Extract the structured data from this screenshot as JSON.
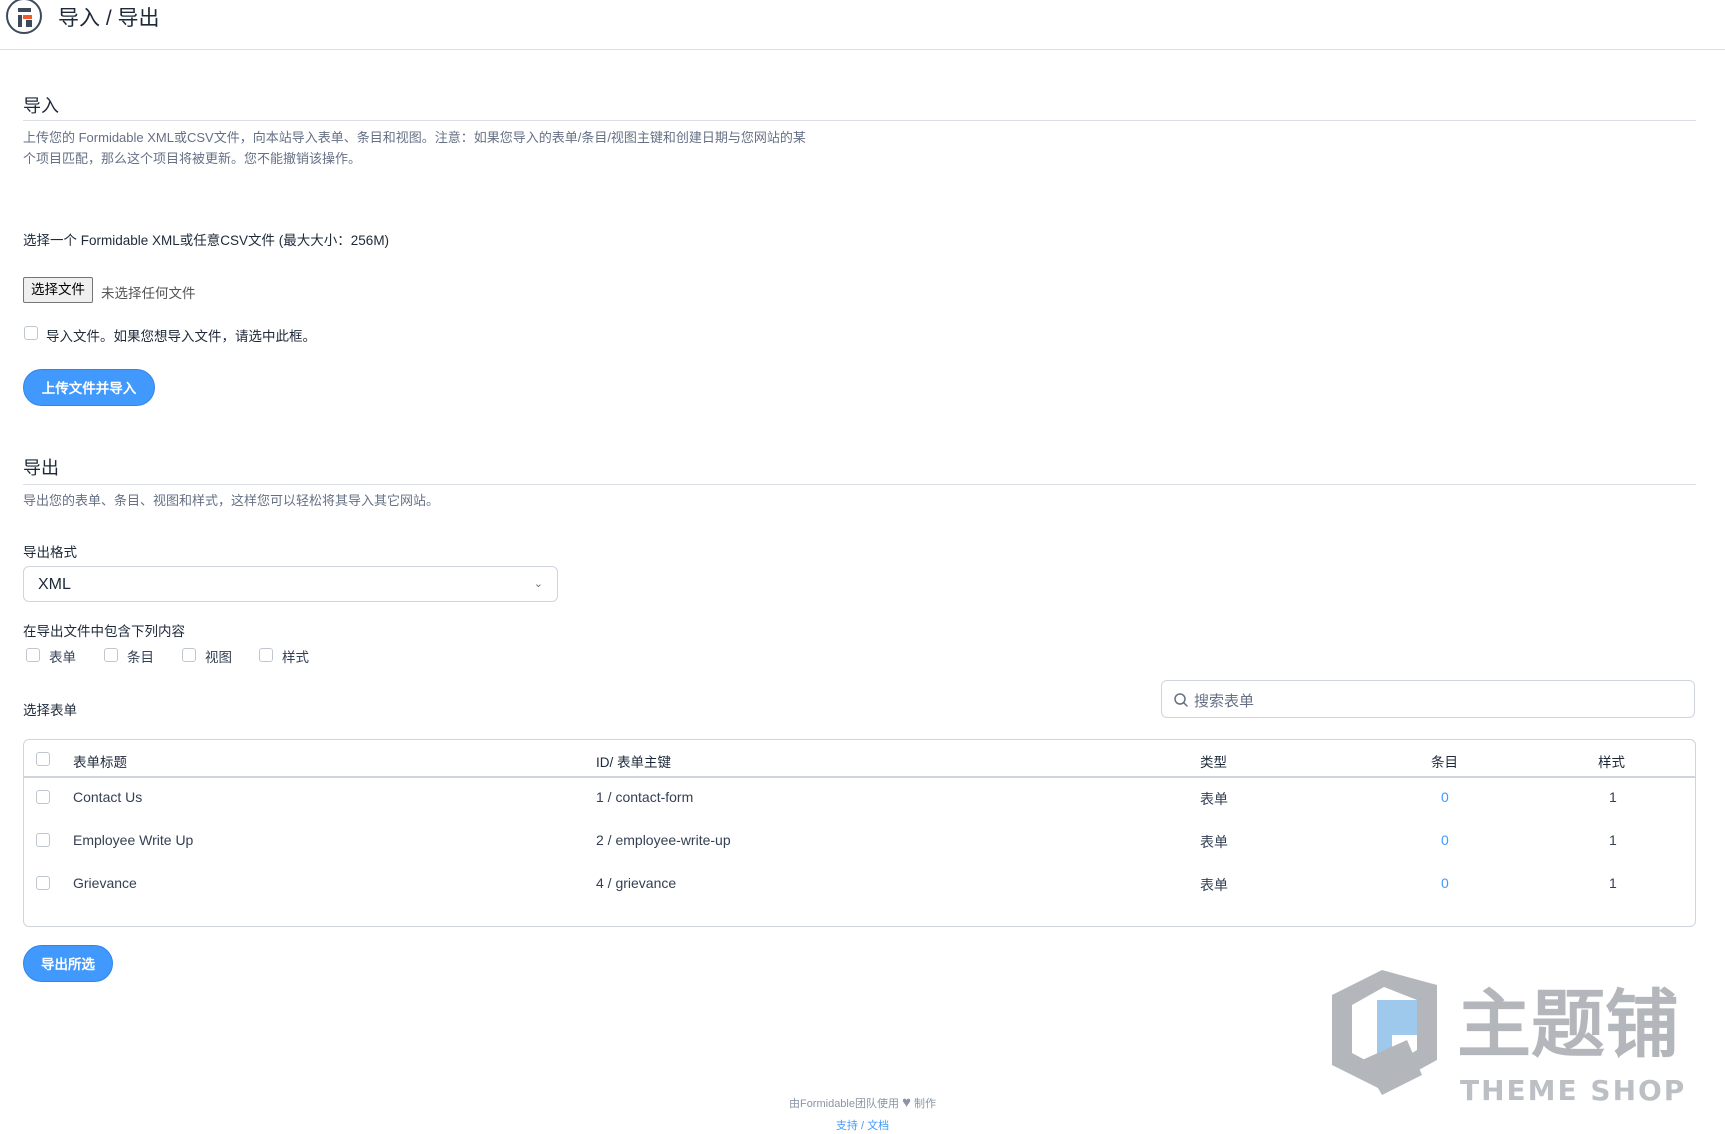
{
  "header": {
    "title": "导入 / 导出"
  },
  "import": {
    "title": "导入",
    "desc_line1": "上传您的 Formidable XML或CSV文件，向本站导入表单、条目和视图。注意：如果您导入的表单/条目/视图主键和创建日期与您网站的某",
    "desc_line2": "个项目匹配，那么这个项目将被更新。您不能撤销该操作。",
    "file_label": "选择一个 Formidable XML或任意CSV文件 (最大大小：256M)",
    "file_button": "选择文件",
    "file_status": "未选择任何文件",
    "checkbox_label": "导入文件。如果您想导入文件，请选中此框。",
    "submit_button": "上传文件并导入"
  },
  "export": {
    "title": "导出",
    "desc": "导出您的表单、条目、视图和样式，这样您可以轻松将其导入其它网站。",
    "format_label": "导出格式",
    "format_value": "XML",
    "include_label": "在导出文件中包含下列内容",
    "include_options": [
      "表单",
      "条目",
      "视图",
      "样式"
    ],
    "select_forms_label": "选择表单",
    "search_placeholder": "搜索表单",
    "table": {
      "headers": [
        "表单标题",
        "ID/ 表单主键",
        "类型",
        "条目",
        "样式"
      ],
      "rows": [
        {
          "title": "Contact Us",
          "id_key": "1 / contact-form",
          "type": "表单",
          "entries": "0",
          "style": "1"
        },
        {
          "title": "Employee Write Up",
          "id_key": "2 / employee-write-up",
          "type": "表单",
          "entries": "0",
          "style": "1"
        },
        {
          "title": "Grievance",
          "id_key": "4 / grievance",
          "type": "表单",
          "entries": "0",
          "style": "1"
        }
      ]
    },
    "submit_button": "导出所选"
  },
  "footer": {
    "made_by_prefix": "由Formidable团队使用",
    "made_by_suffix": "制作",
    "support": "支持",
    "separator": " / ",
    "docs": "文档"
  },
  "watermark": {
    "text_cn": "主题铺",
    "text_en": "THEME SHOP"
  },
  "colors": {
    "accent": "#4199fd",
    "text": "#1d2939",
    "muted": "#667085",
    "border": "#d0d5dd"
  }
}
